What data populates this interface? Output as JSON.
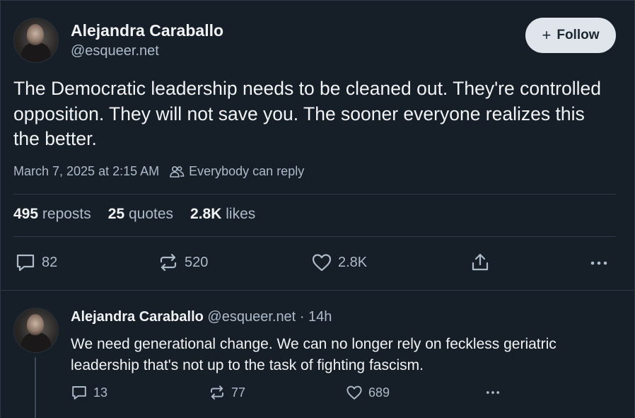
{
  "post": {
    "author_name": "Alejandra Caraballo",
    "author_handle": "@esqueer.net",
    "follow_label": "Follow",
    "text": "The Democratic leadership needs to be cleaned out. They're controlled opposition. They will not save you. The sooner everyone realizes this the better.",
    "timestamp": "March 7, 2025 at 2:15 AM",
    "reply_setting": "Everybody can reply",
    "stats": {
      "reposts_count": "495",
      "reposts_label": "reposts",
      "quotes_count": "25",
      "quotes_label": "quotes",
      "likes_count": "2.8K",
      "likes_label": "likes"
    },
    "actions": {
      "replies": "82",
      "reposts": "520",
      "likes": "2.8K"
    }
  },
  "reply": {
    "author_name": "Alejandra Caraballo",
    "author_handle": "@esqueer.net",
    "time": "· 14h",
    "text": "We need generational change. We can no longer rely on feckless geriatric leadership that's not up to the task of fighting fascism.",
    "actions": {
      "replies": "13",
      "reposts": "77",
      "likes": "689"
    }
  },
  "icons": {
    "reply": "speech-bubble-icon",
    "repost": "repost-arrows-icon",
    "like": "heart-icon",
    "share": "share-icon",
    "more": "more-dots-icon",
    "audience": "people-icon",
    "follow": "plus-icon"
  },
  "colors": {
    "background": "#161e27",
    "text_primary": "#f1f3f5",
    "text_secondary": "#aebbc9",
    "follow_button": "#dfe5eb",
    "divider": "#2e3a47"
  }
}
